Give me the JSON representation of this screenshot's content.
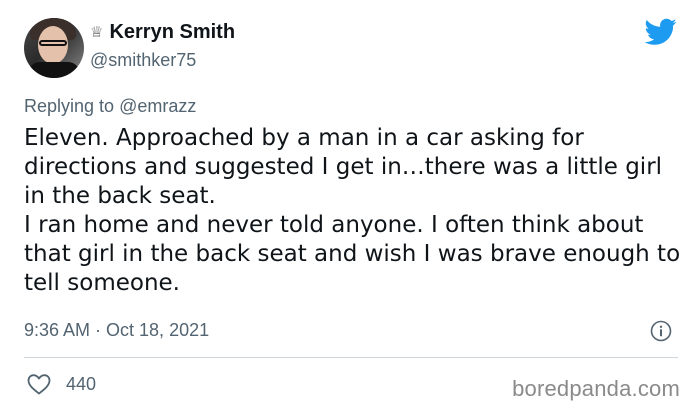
{
  "author": {
    "display_name": "Kerryn Smith",
    "handle": "@smithker75",
    "badge_icon": "crown-icon"
  },
  "reply": {
    "prefix": "Replying to",
    "mention": "@emrazz"
  },
  "tweet": {
    "paragraphs": [
      "Eleven. Approached by a man in a car asking for directions and suggested I get in…there was a little girl in the back seat.",
      "I ran home and never told anyone. I often think about that girl in the back seat and wish I was brave enough to tell someone."
    ],
    "timestamp": "9:36 AM · Oct 18, 2021"
  },
  "engagement": {
    "like_count": "440"
  },
  "watermark": "boredpanda.com",
  "colors": {
    "twitter_blue": "#1d9bf0",
    "secondary_text": "#536471",
    "primary_text": "#0f1419"
  }
}
